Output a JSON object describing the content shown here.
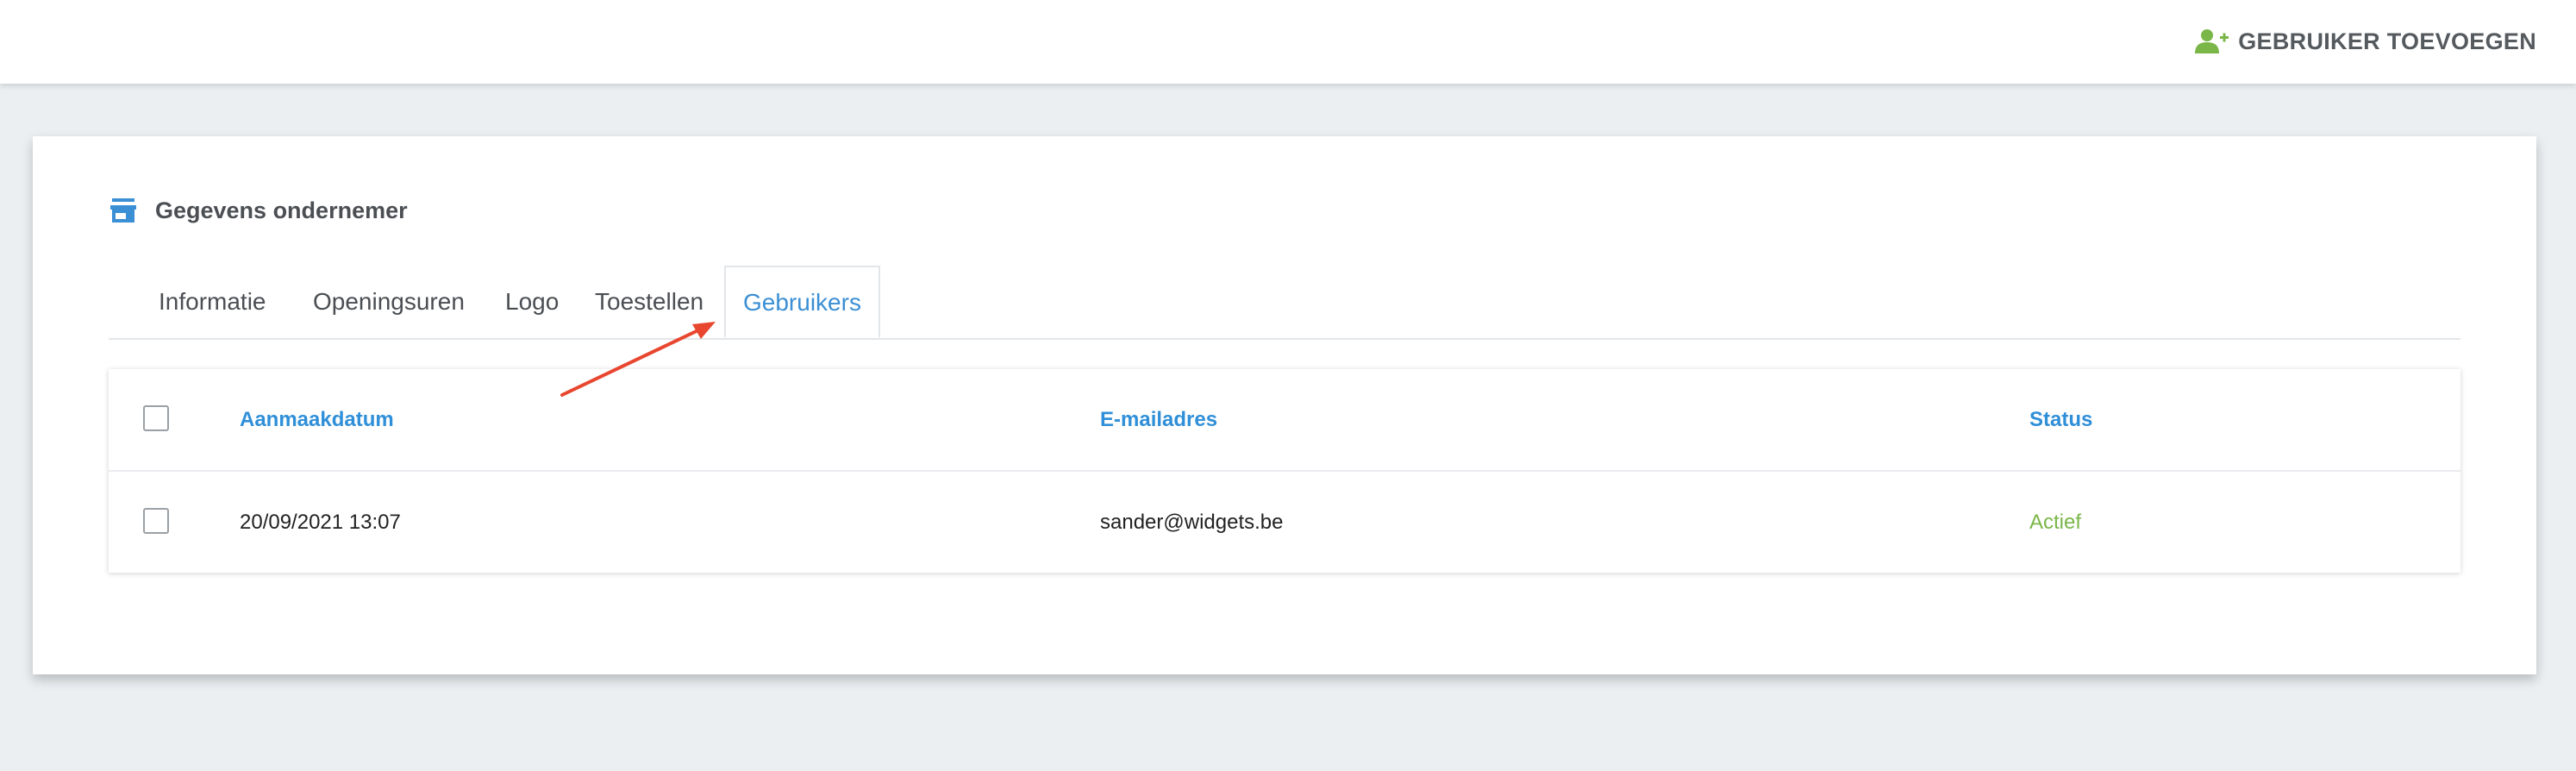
{
  "topbar": {
    "add_user_label": "GEBRUIKER TOEVOEGEN",
    "add_user_icon": "user-plus-icon",
    "accent_color": "#7ab648"
  },
  "card": {
    "title": "Gegevens ondernemer",
    "title_icon": "store-icon"
  },
  "tabs": [
    {
      "label": "Informatie",
      "active": false
    },
    {
      "label": "Openingsuren",
      "active": false
    },
    {
      "label": "Logo",
      "active": false
    },
    {
      "label": "Toestellen",
      "active": false
    },
    {
      "label": "Gebruikers",
      "active": true
    }
  ],
  "table": {
    "columns": [
      "Aanmaakdatum",
      "E-mailadres",
      "Status"
    ],
    "rows": [
      {
        "created": "20/09/2021 13:07",
        "email": "sander@widgets.be",
        "status": "Actief"
      }
    ]
  },
  "annotation": {
    "type": "arrow",
    "color": "#e8462f",
    "points_to": "tab-gebruikers"
  }
}
